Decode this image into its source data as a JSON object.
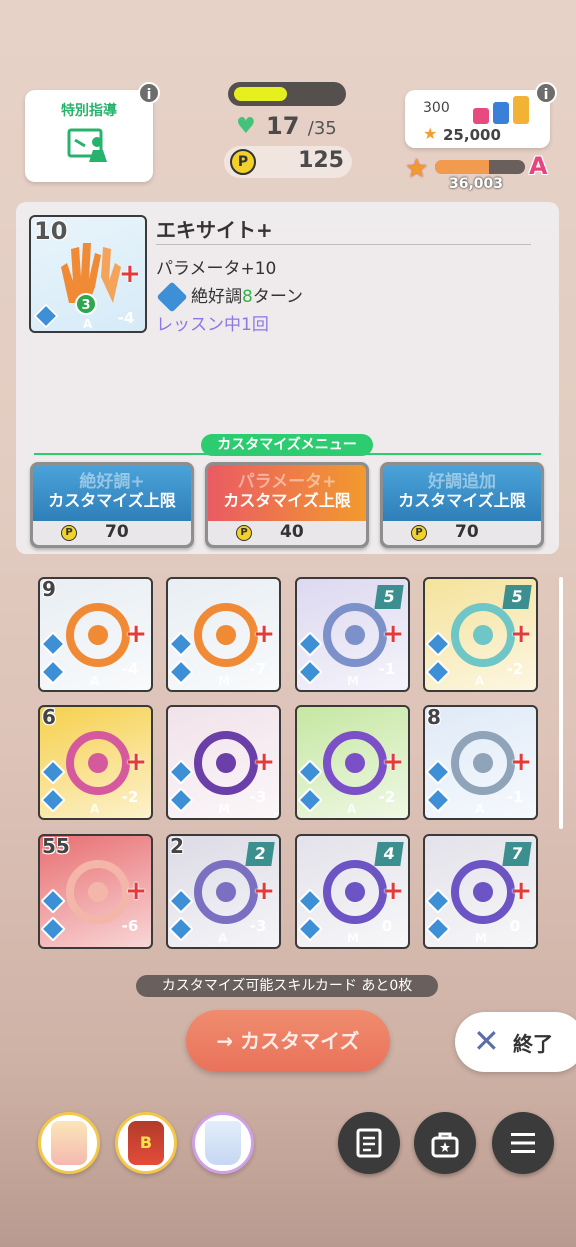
{
  "hud": {
    "special_guidance_label": "特別指導",
    "info_label": "i",
    "stamina_fraction": 0.5,
    "hp_current": "17",
    "hp_max": "/35",
    "p_coin_symbol": "P",
    "p_points": "125",
    "score_300": "300",
    "score_total": "25,000",
    "rank_progress_fraction": 0.6,
    "rank_value": "36,003",
    "rank_letter": "A",
    "score_bar_colors": [
      "#e84a7f",
      "#3a7fd8",
      "#f2b233"
    ]
  },
  "detail": {
    "card_level": "10",
    "card_title": "エキサイト+",
    "effect1": "パラメータ+10",
    "effect2_prefix": "絶好調",
    "effect2_num": "8",
    "effect2_suffix": "ターン",
    "effect3": "レッスン中1回",
    "card_badge_num": "3",
    "card_cost": "-4",
    "card_type_letter": "A",
    "customize_menu_label": "カスタマイズメニュー",
    "options": [
      {
        "ghost": "絶好調+",
        "label": "カスタマイズ上限",
        "cost": "70",
        "color_top": "#4aa3d9",
        "color_bottom": "#2f7fb9"
      },
      {
        "ghost": "パラメータ+",
        "label": "カスタマイズ上限",
        "cost": "40",
        "color_top": "#ea5b63",
        "color_bottom": "#f29a2e"
      },
      {
        "ghost": "好調追加",
        "label": "カスタマイズ上限",
        "cost": "70",
        "color_top": "#4aa3d9",
        "color_bottom": "#2f7fb9"
      }
    ]
  },
  "cards": [
    {
      "num": "9",
      "boxnum": "",
      "cost": "-4",
      "letter": "A",
      "bg": "#e8eef3",
      "art": "#f08a35"
    },
    {
      "num": "",
      "boxnum": "",
      "cost": "-7",
      "letter": "M",
      "bg": "#e8eef3",
      "art": "#f08a35"
    },
    {
      "num": "",
      "boxnum": "5",
      "cost": "-1",
      "letter": "M",
      "bg": "#ddd8f0",
      "art": "#7c90c9"
    },
    {
      "num": "",
      "boxnum": "5",
      "cost": "-2",
      "letter": "A",
      "bg": "#f5e29a",
      "art": "#6fc6c6"
    },
    {
      "num": "6",
      "boxnum": "",
      "cost": "-2",
      "letter": "A",
      "bg": "#f6d04d",
      "art": "#d55a9d"
    },
    {
      "num": "",
      "boxnum": "",
      "cost": "-3",
      "letter": "M",
      "bg": "#f1e2ea",
      "art": "#6b3fa8"
    },
    {
      "num": "",
      "boxnum": "",
      "cost": "-2",
      "letter": "A",
      "bg": "#c6e7a2",
      "art": "#7b4fc7"
    },
    {
      "num": "8",
      "boxnum": "",
      "cost": "-1",
      "letter": "A",
      "bg": "#dfeaf7",
      "art": "#8fa4b8"
    },
    {
      "num": "55",
      "boxnum": "",
      "cost": "-6",
      "letter": "",
      "bg": "#e86f72",
      "art": "#f4b6a8"
    },
    {
      "num": "2",
      "boxnum": "2",
      "cost": "-3",
      "letter": "A",
      "bg": "#dcdbe6",
      "art": "#7a6fc0"
    },
    {
      "num": "",
      "boxnum": "4",
      "cost": "0",
      "letter": "M",
      "bg": "#e3e2ea",
      "art": "#6c54c4"
    },
    {
      "num": "",
      "boxnum": "7",
      "cost": "0",
      "letter": "M",
      "bg": "#e3e2ea",
      "art": "#6c54c4"
    }
  ],
  "plus_symbol": "+",
  "remaining_text": "カスタマイズ可能スキルカード あと0枚",
  "customize_button": "カスタマイズ",
  "end_button": "終了",
  "end_icon": "✕",
  "arrow_icon": "→",
  "bottom": {
    "items": [
      "strawberry-drink",
      "energy-drink",
      "juice-cup"
    ],
    "item_label_B": "B",
    "memo_icon": "memo-icon",
    "bag_icon": "bag-icon",
    "menu_icon": "menu-icon"
  }
}
